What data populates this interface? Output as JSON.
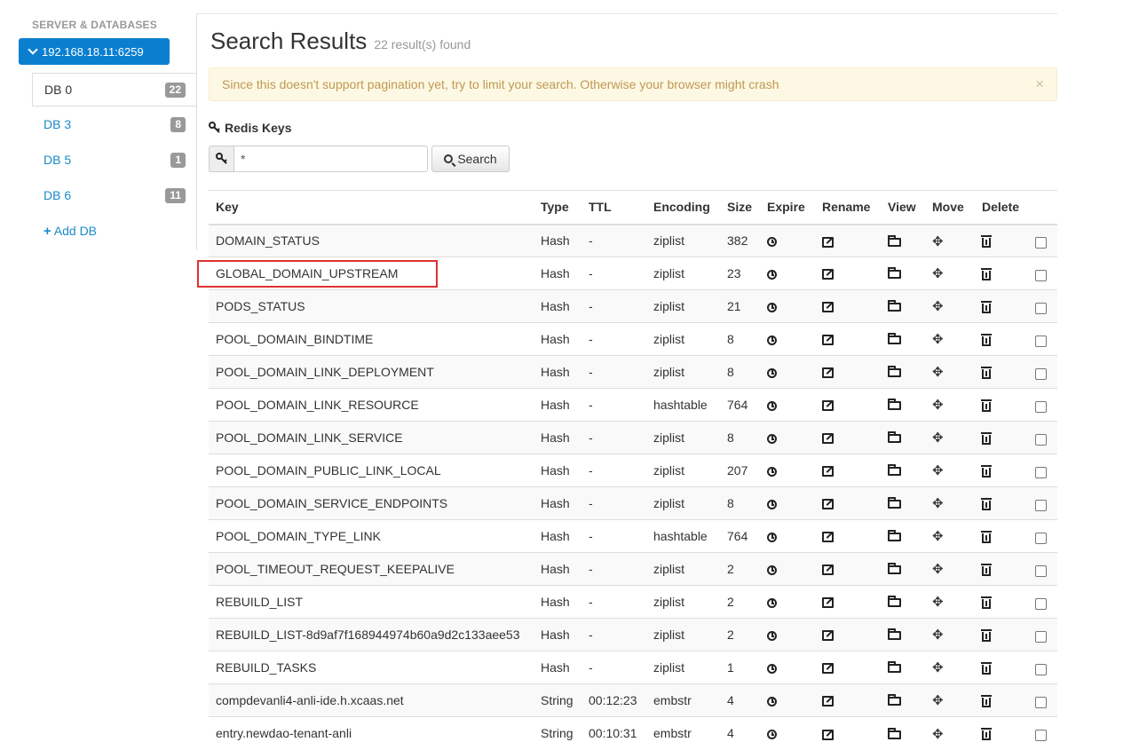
{
  "sidebar": {
    "header": "SERVER & DATABASES",
    "server": "192.168.18.11:6259",
    "databases": [
      {
        "label": "DB 0",
        "count": "22"
      },
      {
        "label": "DB 3",
        "count": "8"
      },
      {
        "label": "DB 5",
        "count": "1"
      },
      {
        "label": "DB 6",
        "count": "11"
      }
    ],
    "add_db": "Add DB"
  },
  "main": {
    "title": "Search Results",
    "result_count": "22 result(s) found",
    "alert": "Since this doesn't support pagination yet, try to limit your search. Otherwise your browser might crash",
    "alert_close": "×",
    "keys_heading": "Redis Keys",
    "search_value": "*",
    "search_button": "Search"
  },
  "table": {
    "headers": [
      "Key",
      "Type",
      "TTL",
      "Encoding",
      "Size",
      "Expire",
      "Rename",
      "View",
      "Move",
      "Delete"
    ],
    "rows": [
      {
        "key": "DOMAIN_STATUS",
        "type": "Hash",
        "ttl": "-",
        "encoding": "ziplist",
        "size": "382"
      },
      {
        "key": "GLOBAL_DOMAIN_UPSTREAM",
        "type": "Hash",
        "ttl": "-",
        "encoding": "ziplist",
        "size": "23"
      },
      {
        "key": "PODS_STATUS",
        "type": "Hash",
        "ttl": "-",
        "encoding": "ziplist",
        "size": "21"
      },
      {
        "key": "POOL_DOMAIN_BINDTIME",
        "type": "Hash",
        "ttl": "-",
        "encoding": "ziplist",
        "size": "8"
      },
      {
        "key": "POOL_DOMAIN_LINK_DEPLOYMENT",
        "type": "Hash",
        "ttl": "-",
        "encoding": "ziplist",
        "size": "8"
      },
      {
        "key": "POOL_DOMAIN_LINK_RESOURCE",
        "type": "Hash",
        "ttl": "-",
        "encoding": "hashtable",
        "size": "764"
      },
      {
        "key": "POOL_DOMAIN_LINK_SERVICE",
        "type": "Hash",
        "ttl": "-",
        "encoding": "ziplist",
        "size": "8"
      },
      {
        "key": "POOL_DOMAIN_PUBLIC_LINK_LOCAL",
        "type": "Hash",
        "ttl": "-",
        "encoding": "ziplist",
        "size": "207"
      },
      {
        "key": "POOL_DOMAIN_SERVICE_ENDPOINTS",
        "type": "Hash",
        "ttl": "-",
        "encoding": "ziplist",
        "size": "8"
      },
      {
        "key": "POOL_DOMAIN_TYPE_LINK",
        "type": "Hash",
        "ttl": "-",
        "encoding": "hashtable",
        "size": "764"
      },
      {
        "key": "POOL_TIMEOUT_REQUEST_KEEPALIVE",
        "type": "Hash",
        "ttl": "-",
        "encoding": "ziplist",
        "size": "2"
      },
      {
        "key": "REBUILD_LIST",
        "type": "Hash",
        "ttl": "-",
        "encoding": "ziplist",
        "size": "2"
      },
      {
        "key": "REBUILD_LIST-8d9af7f168944974b60a9d2c133aee53",
        "type": "Hash",
        "ttl": "-",
        "encoding": "ziplist",
        "size": "2"
      },
      {
        "key": "REBUILD_TASKS",
        "type": "Hash",
        "ttl": "-",
        "encoding": "ziplist",
        "size": "1"
      },
      {
        "key": "compdevanli4-anli-ide.h.xcaas.net",
        "type": "String",
        "ttl": "00:12:23",
        "encoding": "embstr",
        "size": "4"
      },
      {
        "key": "entry.newdao-tenant-anli",
        "type": "String",
        "ttl": "00:10:31",
        "encoding": "embstr",
        "size": "4"
      }
    ]
  },
  "colors": {
    "accent": "#0a7fd0",
    "link": "#1a8ac8",
    "alert_bg": "#fcf8e3",
    "alert_text": "#c09853",
    "highlight": "#e03131"
  }
}
